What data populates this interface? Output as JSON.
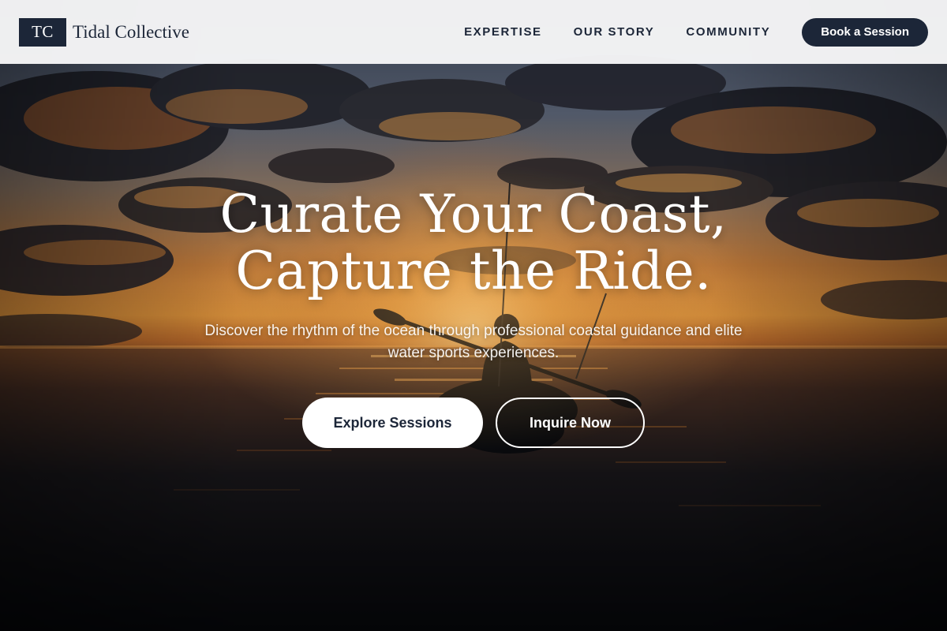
{
  "brand": {
    "mark": "TC",
    "name": "Tidal Collective"
  },
  "nav": {
    "links": [
      "EXPERTISE",
      "OUR STORY",
      "COMMUNITY"
    ],
    "cta_label": "Book a Session"
  },
  "hero": {
    "title_line_1": "Curate Your Coast,",
    "title_line_2": "Capture the Ride.",
    "subtitle": "Discover the rhythm of the ocean through professional coastal guidance and elite water sports experiences.",
    "primary_button": "Explore Sessions",
    "secondary_button": "Inquire Now",
    "background_scene": "sunset-kayaker-photo"
  },
  "colors": {
    "navy": "#1c2638",
    "header_bg": "#f7f7f8",
    "white": "#ffffff"
  }
}
